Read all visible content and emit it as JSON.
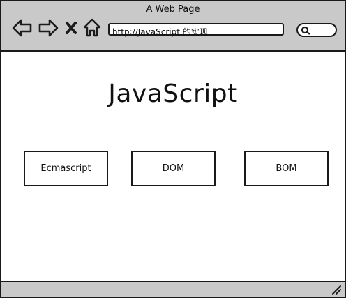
{
  "window": {
    "title": "A Web Page"
  },
  "toolbar": {
    "back_icon": "back-arrow-icon",
    "forward_icon": "forward-arrow-icon",
    "stop_icon": "close-icon",
    "home_icon": "home-icon",
    "address_value": "http://JavaScript 的实现",
    "search_icon": "search-icon"
  },
  "main": {
    "heading": "JavaScript",
    "boxes": [
      {
        "label": "Ecmascript"
      },
      {
        "label": "DOM"
      },
      {
        "label": "BOM"
      }
    ]
  },
  "statusbar": {
    "resize_icon": "resize-grip-icon"
  }
}
